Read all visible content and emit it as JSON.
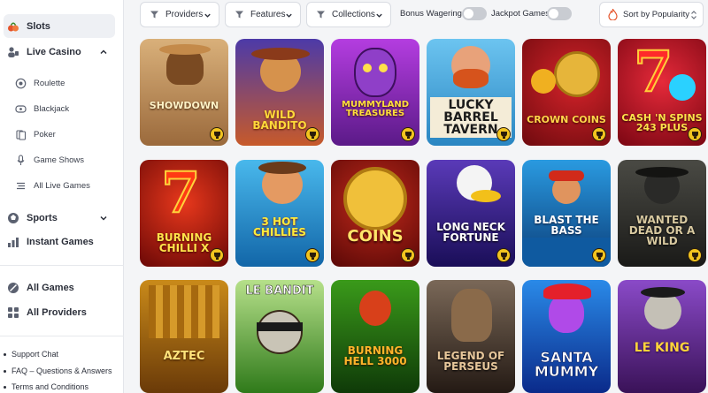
{
  "sidebar": {
    "main": [
      {
        "label": "Slots",
        "icon": "slots-icon",
        "active": true,
        "chevron": false
      },
      {
        "label": "Live Casino",
        "icon": "live-casino-icon",
        "active": false,
        "chevron": "up"
      }
    ],
    "live_sub": [
      {
        "label": "Roulette",
        "icon": "roulette-icon"
      },
      {
        "label": "Blackjack",
        "icon": "blackjack-icon"
      },
      {
        "label": "Poker",
        "icon": "poker-icon"
      },
      {
        "label": "Game Shows",
        "icon": "microphone-icon"
      },
      {
        "label": "All Live Games",
        "icon": "list-icon"
      }
    ],
    "sports": {
      "label": "Sports",
      "icon": "sports-icon"
    },
    "instant": {
      "label": "Instant Games",
      "icon": "instant-games-icon"
    },
    "all_games": {
      "label": "All Games",
      "icon": "all-games-icon"
    },
    "all_providers": {
      "label": "All Providers",
      "icon": "all-providers-icon"
    },
    "footer": [
      "Support Chat",
      "FAQ – Questions & Answers",
      "Terms and Conditions"
    ]
  },
  "filters": {
    "providers": "Providers",
    "features": "Features",
    "collections": "Collections",
    "bonus_wagering": "Bonus Wagering",
    "jackpot_games": "Jackpot Games",
    "sort": "Sort by Popularity"
  },
  "colors": {
    "accent": "#e5542b",
    "badge": "#f2c41f"
  },
  "games": [
    {
      "title": "SHOWDOWN",
      "bg": "#b9875a"
    },
    {
      "title": "WILD BANDITO",
      "bg": "#6a3fb5"
    },
    {
      "title": "MUMMYLAND TREASURES",
      "bg": "#8a28b5"
    },
    {
      "title": "LUCKY BARREL TAVERN",
      "bg": "#4fa6d8"
    },
    {
      "title": "CROWN COINS",
      "bg": "#b51818"
    },
    {
      "title": "CASH 'N SPINS 243 PLUS",
      "bg": "#c4152a"
    },
    {
      "title": "BURNING CHILLI X",
      "bg": "#a8160e"
    },
    {
      "title": "3 HOT CHILLIES",
      "bg": "#1f97d6"
    },
    {
      "title": "COINS",
      "bg": "#8e1914"
    },
    {
      "title": "LONG NECK FORTUNE",
      "bg": "#2f1a73"
    },
    {
      "title": "BLAST THE BASS",
      "bg": "#1c76b2"
    },
    {
      "title": "WANTED DEAD OR A WILD",
      "bg": "#2d2d2b"
    },
    {
      "title": "AZTEC",
      "bg": "#a36a12"
    },
    {
      "title": "LE BANDIT",
      "bg": "#3a9a2a"
    },
    {
      "title": "BURNING HELL 3000",
      "bg": "#2a6b14"
    },
    {
      "title": "LEGEND OF PERSEUS",
      "bg": "#4a3a30"
    },
    {
      "title": "SANTA MUMMY",
      "bg": "#1b4fc4"
    },
    {
      "title": "LE KING",
      "bg": "#5a2a8a"
    }
  ]
}
